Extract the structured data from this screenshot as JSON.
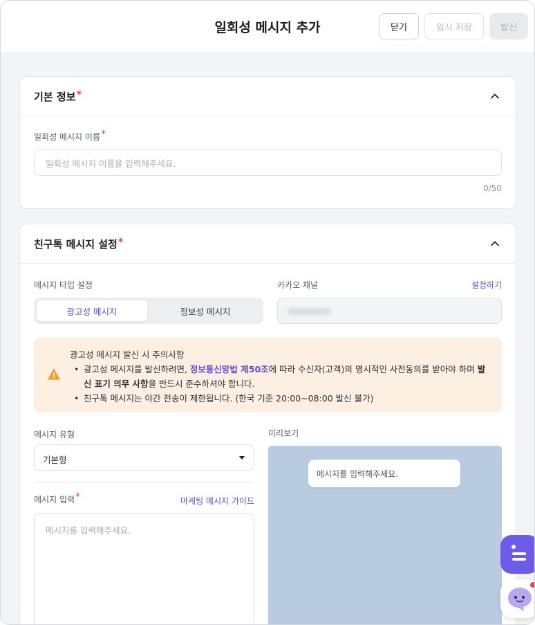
{
  "header": {
    "title": "일회성 메시지 추가",
    "close_label": "닫기",
    "draft_label": "임시 저장",
    "send_label": "발신"
  },
  "basic_info": {
    "section_title": "기본 정보",
    "required_mark": "*",
    "name_label": "일회성 메시지 이름",
    "name_placeholder": "일회성 메시지 이름을 입력해주세요.",
    "name_value": "",
    "counter": "0/50"
  },
  "friend_talk": {
    "section_title": "친구톡 메시지 설정",
    "required_mark": "*",
    "type_label": "메시지 타입 설정",
    "type_options": [
      "광고성 메시지",
      "정보성 메시지"
    ],
    "type_selected": "광고성 메시지",
    "channel_label": "카카오 채널",
    "channel_link": "설정하기",
    "notice": {
      "title": "광고성 메시지 발신 시 주의사항",
      "item1_pre": "광고성 메시지를 발신하려면, ",
      "item1_highlight": "정보통신망법 제50조",
      "item1_mid": "에 따라 수신자(고객)의 명시적인 사전동의를 받아야 하며 ",
      "item1_bold": "발신 표기 의무 사항",
      "item1_post": "을 반드시 준수하셔야 합니다.",
      "item2": "친구톡 메시지는 야간 전송이 제한됩니다. (한국 기준 20:00~08:00 발신 불가)"
    },
    "msg_kind_label": "메시지 유형",
    "msg_kind_value": "기본형",
    "msg_input_label": "메시지 입력",
    "msg_input_required": "*",
    "marketing_guide_link": "마케팅 메시지 가이드",
    "msg_input_placeholder": "메시지를 입력해주세요.",
    "preview_label": "미리보기",
    "preview_bubble": "메시지를 입력해주세요."
  },
  "icons": {
    "collapse": "chevron-up-icon",
    "warning": "warning-icon",
    "dropdown": "caret-down-icon",
    "chat_widget": "chat-bot-icon",
    "help_widget": "messenger-icon"
  },
  "colors": {
    "accent": "#5b4fd6",
    "required": "#e5484d",
    "notice_bg": "#fdf0e2",
    "warning": "#f0a23a",
    "preview_bg": "#b9cbe0",
    "fab": "#6c5ce7"
  }
}
